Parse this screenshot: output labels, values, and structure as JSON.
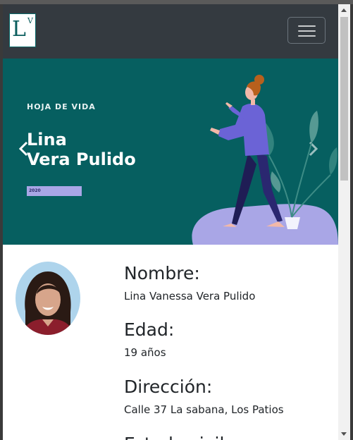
{
  "navbar": {
    "logo_main": "L",
    "logo_sup": "V",
    "toggler_icon": "hamburger-icon"
  },
  "hero": {
    "kicker": "HOJA DE VIDA",
    "name_line1": "Lina",
    "name_line2": "Vera Pulido",
    "year_badge": "2020",
    "prev_icon": "chevron-left-icon",
    "next_icon": "chevron-right-icon",
    "colors": {
      "background": "#065f60",
      "accent": "#a9a6e6",
      "figure_shirt": "#6b63d6"
    }
  },
  "profile": {
    "fields": [
      {
        "label": "Nombre:",
        "value": "Lina Vanessa Vera Pulido"
      },
      {
        "label": "Edad:",
        "value": "19 años"
      },
      {
        "label": "Dirección:",
        "value": "Calle 37 La sabana, Los Patios"
      },
      {
        "label": "Estado civil:",
        "value": ""
      }
    ]
  }
}
